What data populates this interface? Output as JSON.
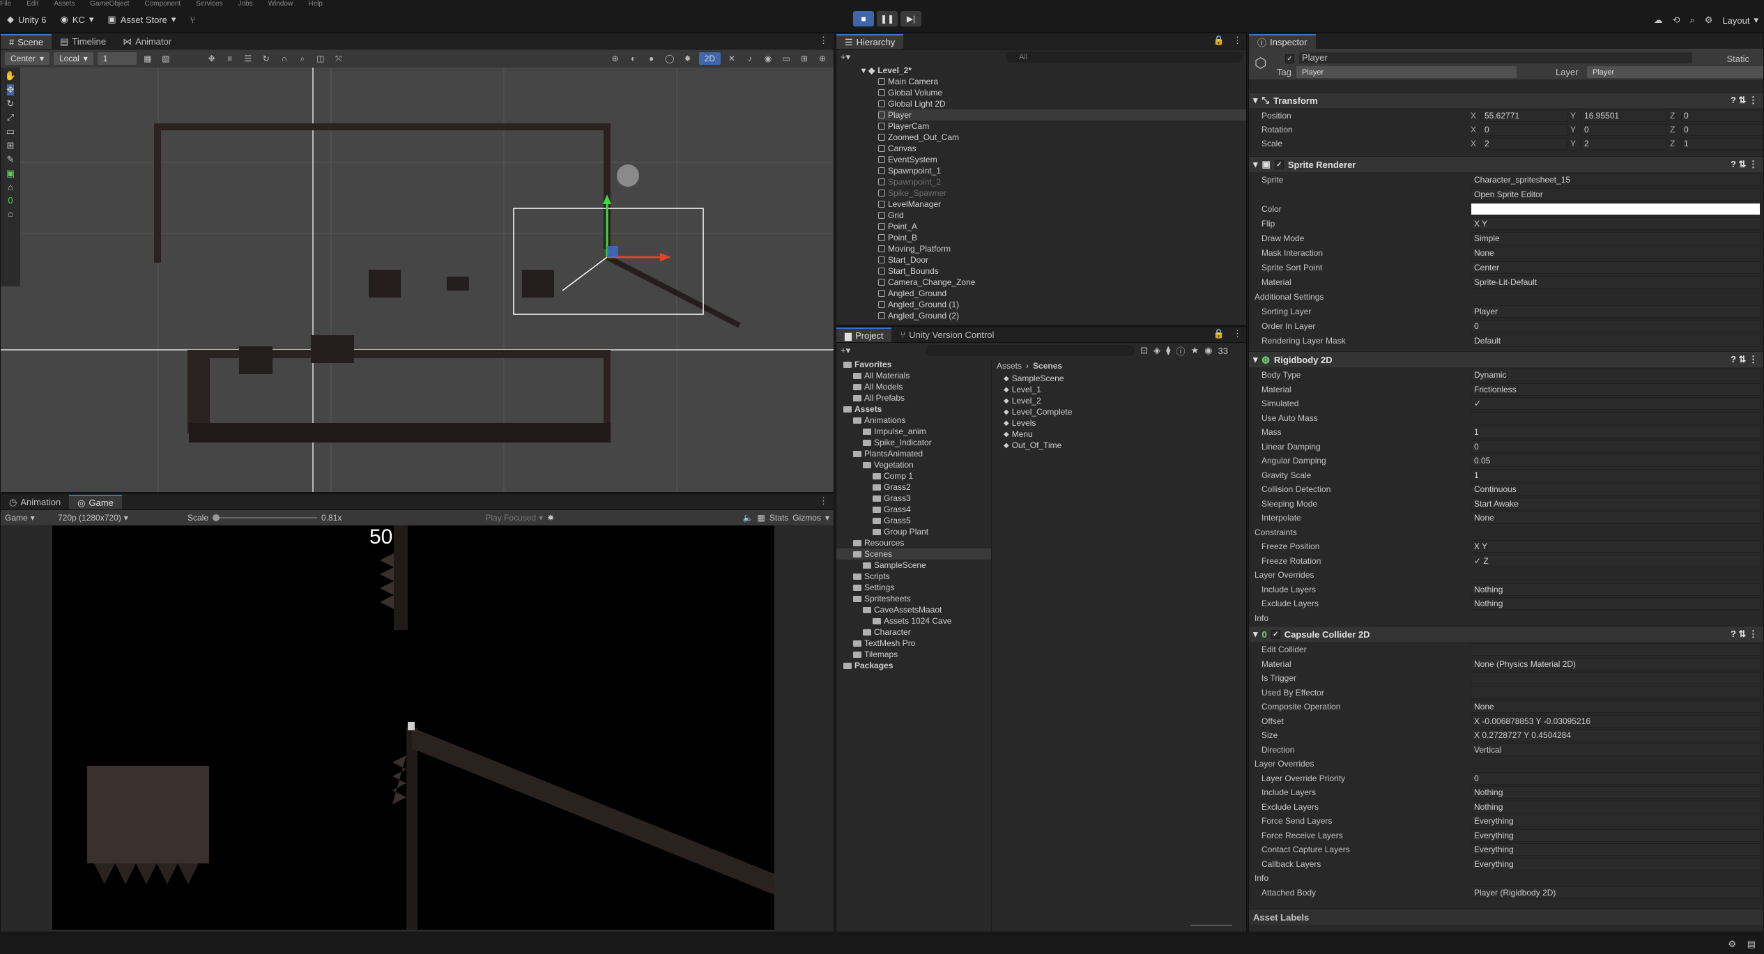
{
  "menu": [
    "File",
    "Edit",
    "Assets",
    "GameObject",
    "Component",
    "Services",
    "Jobs",
    "Window",
    "Help"
  ],
  "toolbar": {
    "app": "Unity 6",
    "account": "KC",
    "asset_store": "Asset Store",
    "layout": "Layout"
  },
  "scene_panel": {
    "tabs": [
      "Scene",
      "Timeline",
      "Animator"
    ],
    "pivot": "Center",
    "space": "Local",
    "grid_snap": "1",
    "mode2d": "2D"
  },
  "game_panel": {
    "tabs": [
      "Animation",
      "Game"
    ],
    "display": "Game",
    "resolution": "720p (1280x720)",
    "scale_label": "Scale",
    "scale_value": "0.81x",
    "play_focused": "Play Focused",
    "stats": "Stats",
    "gizmos": "Gizmos",
    "score": "50"
  },
  "hierarchy": {
    "tab": "Hierarchy",
    "search_placeholder": "All",
    "scene": "Level_2*",
    "items": [
      {
        "name": "Main Camera",
        "dim": false
      },
      {
        "name": "Global Volume",
        "dim": false
      },
      {
        "name": "Global Light 2D",
        "dim": false
      },
      {
        "name": "Player",
        "dim": false,
        "selected": true
      },
      {
        "name": "PlayerCam",
        "dim": false
      },
      {
        "name": "Zoomed_Out_Cam",
        "dim": false
      },
      {
        "name": "Canvas",
        "dim": false
      },
      {
        "name": "EventSystem",
        "dim": false
      },
      {
        "name": "Spawnpoint_1",
        "dim": false
      },
      {
        "name": "Spawnpoint_2",
        "dim": true
      },
      {
        "name": "Spike_Spawner",
        "dim": true
      },
      {
        "name": "LevelManager",
        "dim": false
      },
      {
        "name": "Grid",
        "dim": false
      },
      {
        "name": "Point_A",
        "dim": false
      },
      {
        "name": "Point_B",
        "dim": false
      },
      {
        "name": "Moving_Platform",
        "dim": false
      },
      {
        "name": "Start_Door",
        "dim": false
      },
      {
        "name": "Start_Bounds",
        "dim": false
      },
      {
        "name": "Camera_Change_Zone",
        "dim": false
      },
      {
        "name": "Angled_Ground",
        "dim": false
      },
      {
        "name": "Angled_Ground (1)",
        "dim": false
      },
      {
        "name": "Angled_Ground (2)",
        "dim": false
      }
    ]
  },
  "project": {
    "tabs": [
      "Project",
      "Unity Version Control"
    ],
    "count": "33",
    "tree": [
      {
        "name": "Favorites",
        "depth": 0,
        "bold": true
      },
      {
        "name": "All Materials",
        "depth": 1
      },
      {
        "name": "All Models",
        "depth": 1
      },
      {
        "name": "All Prefabs",
        "depth": 1
      },
      {
        "name": "Assets",
        "depth": 0,
        "bold": true
      },
      {
        "name": "Animations",
        "depth": 1
      },
      {
        "name": "Impulse_anim",
        "depth": 2
      },
      {
        "name": "Spike_Indicator",
        "depth": 2
      },
      {
        "name": "PlantsAnimated",
        "depth": 1
      },
      {
        "name": "Vegetation",
        "depth": 2
      },
      {
        "name": "Comp 1",
        "depth": 3
      },
      {
        "name": "Grass2",
        "depth": 3
      },
      {
        "name": "Grass3",
        "depth": 3
      },
      {
        "name": "Grass4",
        "depth": 3
      },
      {
        "name": "Grass5",
        "depth": 3
      },
      {
        "name": "Group Plant",
        "depth": 3
      },
      {
        "name": "Resources",
        "depth": 1
      },
      {
        "name": "Scenes",
        "depth": 1,
        "selected": true
      },
      {
        "name": "SampleScene",
        "depth": 2
      },
      {
        "name": "Scripts",
        "depth": 1
      },
      {
        "name": "Settings",
        "depth": 1
      },
      {
        "name": "Spritesheets",
        "depth": 1
      },
      {
        "name": "CaveAssetsMaaot",
        "depth": 2
      },
      {
        "name": "Assets 1024 Cave",
        "depth": 3
      },
      {
        "name": "Character",
        "depth": 2
      },
      {
        "name": "TextMesh Pro",
        "depth": 1
      },
      {
        "name": "Tilemaps",
        "depth": 1
      },
      {
        "name": "Packages",
        "depth": 0,
        "bold": true
      }
    ],
    "breadcrumb": [
      "Assets",
      "Scenes"
    ],
    "files": [
      "SampleScene",
      "Level_1",
      "Level_2",
      "Level_Complete",
      "Levels",
      "Menu",
      "Out_Of_Time"
    ]
  },
  "inspector": {
    "tab": "Inspector",
    "object_name": "Player",
    "static": "Static",
    "tag_label": "Tag",
    "tag": "Player",
    "layer_label": "Layer",
    "layer": "Player",
    "transform": {
      "title": "Transform",
      "position": {
        "label": "Position",
        "x": "55.62771",
        "y": "16.95501",
        "z": "0"
      },
      "rotation": {
        "label": "Rotation",
        "x": "0",
        "y": "0",
        "z": "0"
      },
      "scale": {
        "label": "Scale",
        "x": "2",
        "y": "2",
        "z": "1"
      }
    },
    "sprite_renderer": {
      "title": "Sprite Renderer",
      "rows": [
        {
          "label": "Sprite",
          "value": "Character_spritesheet_15"
        },
        {
          "label": "",
          "value": "Open Sprite Editor"
        },
        {
          "label": "Color",
          "value": ""
        },
        {
          "label": "Flip",
          "value": "X    Y"
        },
        {
          "label": "Draw Mode",
          "value": "Simple"
        },
        {
          "label": "Mask Interaction",
          "value": "None"
        },
        {
          "label": "Sprite Sort Point",
          "value": "Center"
        },
        {
          "label": "Material",
          "value": "Sprite-Lit-Default"
        },
        {
          "label": "Additional Settings",
          "value": ""
        },
        {
          "label": "Sorting Layer",
          "value": "Player"
        },
        {
          "label": "Order In Layer",
          "value": "0"
        },
        {
          "label": "Rendering Layer Mask",
          "value": "Default"
        }
      ]
    },
    "rigidbody": {
      "title": "Rigidbody 2D",
      "rows": [
        {
          "label": "Body Type",
          "value": "Dynamic"
        },
        {
          "label": "Material",
          "value": "Frictionless"
        },
        {
          "label": "Simulated",
          "value": "✓"
        },
        {
          "label": "Use Auto Mass",
          "value": ""
        },
        {
          "label": "Mass",
          "value": "1"
        },
        {
          "label": "Linear Damping",
          "value": "0"
        },
        {
          "label": "Angular Damping",
          "value": "0.05"
        },
        {
          "label": "Gravity Scale",
          "value": "1"
        },
        {
          "label": "Collision Detection",
          "value": "Continuous"
        },
        {
          "label": "Sleeping Mode",
          "value": "Start Awake"
        },
        {
          "label": "Interpolate",
          "value": "None"
        },
        {
          "label": "Constraints",
          "value": ""
        },
        {
          "label": "Freeze Position",
          "value": "X    Y"
        },
        {
          "label": "Freeze Rotation",
          "value": "✓ Z"
        },
        {
          "label": "Layer Overrides",
          "value": ""
        },
        {
          "label": "Include Layers",
          "value": "Nothing"
        },
        {
          "label": "Exclude Layers",
          "value": "Nothing"
        },
        {
          "label": "Info",
          "value": ""
        }
      ]
    },
    "capsule": {
      "title": "Capsule Collider 2D",
      "rows": [
        {
          "label": "Edit Collider",
          "value": ""
        },
        {
          "label": "Material",
          "value": "None (Physics Material 2D)"
        },
        {
          "label": "Is Trigger",
          "value": ""
        },
        {
          "label": "Used By Effector",
          "value": ""
        },
        {
          "label": "Composite Operation",
          "value": "None"
        },
        {
          "label": "Offset",
          "value": "X -0.006878853    Y -0.03095216"
        },
        {
          "label": "Size",
          "value": "X 0.2728727    Y 0.4504284"
        },
        {
          "label": "Direction",
          "value": "Vertical"
        },
        {
          "label": "Layer Overrides",
          "value": ""
        },
        {
          "label": "Layer Override Priority",
          "value": "0"
        },
        {
          "label": "Include Layers",
          "value": "Nothing"
        },
        {
          "label": "Exclude Layers",
          "value": "Nothing"
        },
        {
          "label": "Force Send Layers",
          "value": "Everything"
        },
        {
          "label": "Force Receive Layers",
          "value": "Everything"
        },
        {
          "label": "Contact Capture Layers",
          "value": "Everything"
        },
        {
          "label": "Callback Layers",
          "value": "Everything"
        },
        {
          "label": "Info",
          "value": ""
        },
        {
          "label": "Attached Body",
          "value": "Player (Rigidbody 2D)"
        }
      ]
    },
    "asset_labels": "Asset Labels"
  },
  "colors": {
    "accent": "#3a72c9",
    "panel": "#282828",
    "scene_bg": "#464646"
  }
}
